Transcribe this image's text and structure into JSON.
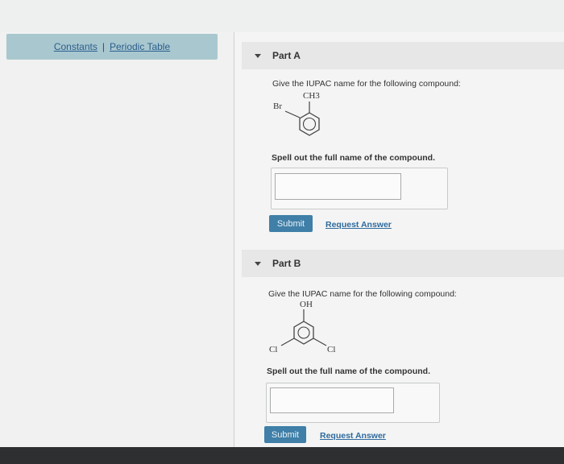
{
  "tools": {
    "constants_label": "Constants",
    "separator": "|",
    "periodic_table_label": "Periodic Table"
  },
  "part_a": {
    "title": "Part A",
    "question": "Give the IUPAC name for the following compound:",
    "molecule_labels": {
      "substituent_top": "CH3",
      "substituent_left": "Br"
    },
    "instruction": "Spell out the full name of the compound.",
    "answer_value": "",
    "submit_label": "Submit",
    "request_label": "Request Answer"
  },
  "part_b": {
    "title": "Part B",
    "question": "Give the IUPAC name for the following compound:",
    "molecule_labels": {
      "substituent_top": "OH",
      "substituent_left": "Cl",
      "substituent_right": "Cl"
    },
    "instruction": "Spell out the full name of the compound.",
    "answer_value": "",
    "submit_label": "Submit",
    "request_label": "Request Answer"
  },
  "colors": {
    "accent": "#3f7fa8",
    "link": "#2f6a9e",
    "tools_bar": "#a9c7cf"
  },
  "icons": {
    "collapse": "caret-down-icon"
  }
}
